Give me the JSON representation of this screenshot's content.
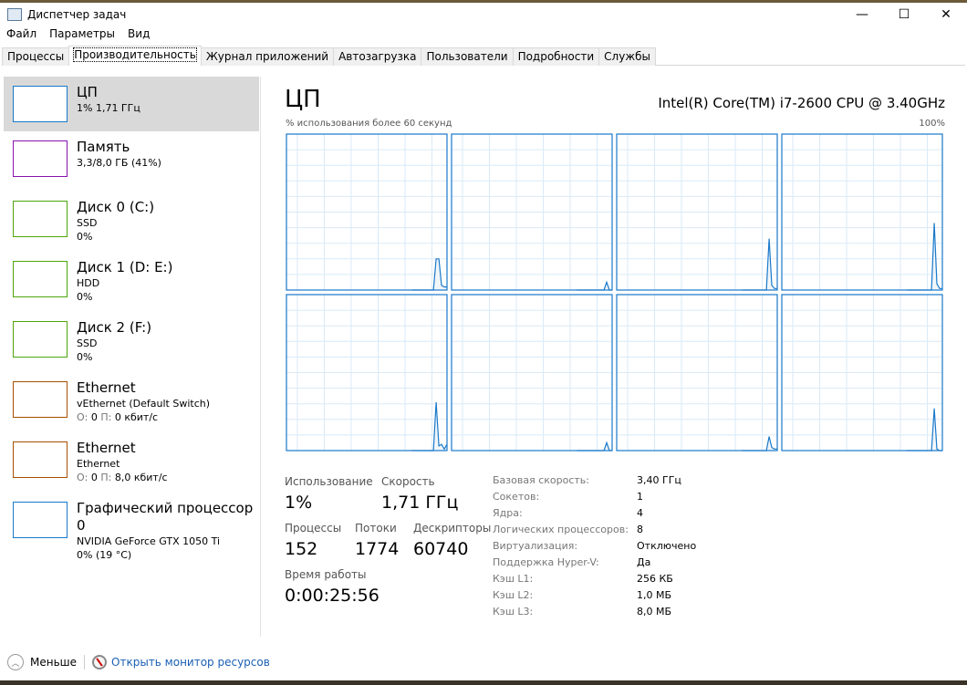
{
  "window": {
    "title": "Диспетчер задач",
    "minimize": "—",
    "maximize": "☐",
    "close": "✕"
  },
  "menu": [
    "Файл",
    "Параметры",
    "Вид"
  ],
  "tabs": [
    "Процессы",
    "Производительность",
    "Журнал приложений",
    "Автозагрузка",
    "Пользователи",
    "Подробности",
    "Службы"
  ],
  "active_tab": 1,
  "sidebar": [
    {
      "name": "ЦП",
      "line1": "1% 1,71 ГГц",
      "line2": "",
      "color": "#1979ca",
      "selected": true
    },
    {
      "name": "Память",
      "line1": "3,3/8,0 ГБ (41%)",
      "line2": "",
      "color": "#8b12ae"
    },
    {
      "name": "Диск 0 (C:)",
      "line1": "SSD",
      "line2": "0%",
      "color": "#4da60c"
    },
    {
      "name": "Диск 1 (D: E:)",
      "line1": "HDD",
      "line2": "0%",
      "color": "#4da60c"
    },
    {
      "name": "Диск 2 (F:)",
      "line1": "SSD",
      "line2": "0%",
      "color": "#4da60c"
    },
    {
      "name": "Ethernet",
      "line1": "vEthernet (Default Switch)",
      "line2_o": "О:",
      "line2_ov": "0",
      "line2_p": "П:",
      "line2_pv": "0 кбит/с",
      "color": "#a74f01"
    },
    {
      "name": "Ethernet",
      "line1": "Ethernet",
      "line2_o": "О:",
      "line2_ov": "0",
      "line2_p": "П:",
      "line2_pv": "8,0 кбит/с",
      "color": "#a74f01"
    },
    {
      "name": "Графический процессор 0",
      "line1": "NVIDIA GeForce GTX 1050 Ti",
      "line2": "0%  (19 °C)",
      "color": "#1979ca"
    }
  ],
  "main": {
    "title": "ЦП",
    "cpu_name": "Intel(R) Core(TM) i7-2600 CPU @ 3.40GHz",
    "graph_label": "% использования более 60 секунд",
    "graph_max": "100%",
    "graph_color": "#1979ca",
    "grid_color": "#d9eaf7",
    "cores": [
      [
        0,
        0,
        0,
        0,
        0,
        0,
        0,
        0,
        20,
        20,
        3,
        2,
        2
      ],
      [
        0,
        0,
        0,
        0,
        0,
        0,
        0,
        0,
        0,
        0,
        5,
        0,
        0
      ],
      [
        0,
        0,
        0,
        0,
        0,
        0,
        0,
        0,
        0,
        33,
        3,
        1,
        1
      ],
      [
        0,
        0,
        0,
        0,
        0,
        0,
        0,
        0,
        0,
        43,
        4,
        1,
        1
      ],
      [
        0,
        0,
        0,
        0,
        0,
        0,
        0,
        0,
        31,
        3,
        4,
        1,
        4
      ],
      [
        0,
        0,
        0,
        0,
        0,
        0,
        0,
        0,
        0,
        0,
        5,
        0,
        0
      ],
      [
        0,
        0,
        0,
        0,
        0,
        0,
        0,
        0,
        0,
        9,
        2,
        1,
        1
      ],
      [
        0,
        0,
        0,
        0,
        0,
        0,
        0,
        0,
        0,
        27,
        1,
        0,
        0
      ]
    ],
    "stats": {
      "usage_label": "Использование",
      "usage": "1%",
      "speed_label": "Скорость",
      "speed": "1,71 ГГц",
      "processes_label": "Процессы",
      "processes": "152",
      "threads_label": "Потоки",
      "threads": "1774",
      "handles_label": "Дескрипторы",
      "handles": "60740",
      "uptime_label": "Время работы",
      "uptime": "0:00:25:56"
    },
    "specs": [
      {
        "k": "Базовая скорость:",
        "v": "3,40 ГГц"
      },
      {
        "k": "Сокетов:",
        "v": "1"
      },
      {
        "k": "Ядра:",
        "v": "4"
      },
      {
        "k": "Логических процессоров:",
        "v": "8"
      },
      {
        "k": "Виртуализация:",
        "v": "Отключено"
      },
      {
        "k": "Поддержка Hyper-V:",
        "v": "Да"
      },
      {
        "k": "Кэш L1:",
        "v": "256 КБ"
      },
      {
        "k": "Кэш L2:",
        "v": "1,0 МБ"
      },
      {
        "k": "Кэш L3:",
        "v": "8,0 МБ"
      }
    ]
  },
  "footer": {
    "less": "Меньше",
    "resmon": "Открыть монитор ресурсов"
  }
}
